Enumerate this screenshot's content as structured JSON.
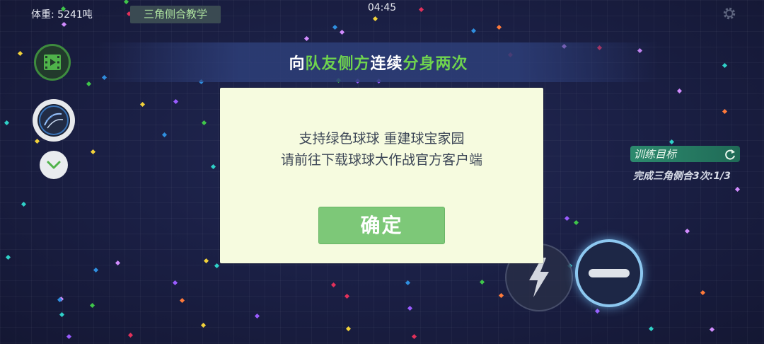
{
  "hud": {
    "weight": "体重: 5241吨",
    "mode_tag": "三角侧合教学",
    "clock": "04:45"
  },
  "banner": {
    "segments": [
      {
        "text": "向",
        "green": false
      },
      {
        "text": "队友侧方",
        "green": true
      },
      {
        "text": "连续",
        "green": false
      },
      {
        "text": "分身两次",
        "green": true
      }
    ]
  },
  "goal": {
    "label": "训练目标",
    "progress": "完成三角侧合3次:1/3"
  },
  "modal": {
    "line1": "支持绿色球球 重建球宝家园",
    "line2": "请前往下载球球大作战官方客户端",
    "confirm": "确定"
  },
  "icons": {
    "video": "video-play-icon",
    "skin": "ball-skin-icon",
    "expand": "chevron-down-icon",
    "settings": "gear-icon",
    "refresh": "refresh-icon",
    "boost": "lightning-icon",
    "split": "split-icon"
  },
  "colors": {
    "background": "#1b2046",
    "accent_green": "#6fd44e",
    "modal_bg": "#f6fbdf",
    "confirm_button": "#7dc878",
    "split_ring": "#8dc8f0"
  }
}
